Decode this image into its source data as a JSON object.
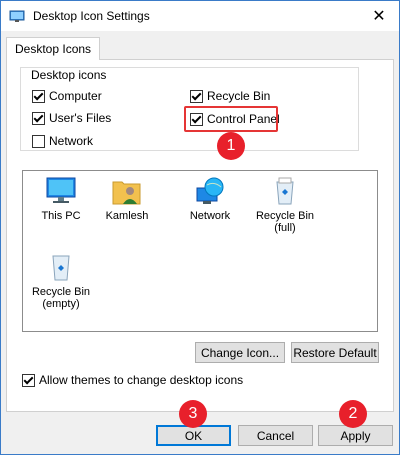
{
  "window": {
    "title": "Desktop Icon Settings",
    "close_glyph": "✕"
  },
  "tabs": [
    {
      "label": "Desktop Icons"
    }
  ],
  "desktop_icons_group": {
    "legend": "Desktop icons",
    "items": [
      {
        "label": "Computer",
        "checked": true
      },
      {
        "label": "User's Files",
        "checked": true
      },
      {
        "label": "Network",
        "checked": false
      },
      {
        "label": "Recycle Bin",
        "checked": true
      },
      {
        "label": "Control Panel",
        "checked": true
      }
    ]
  },
  "icon_list": [
    {
      "label": "This PC",
      "icon": "monitor-icon"
    },
    {
      "label": "Kamlesh",
      "icon": "user-folder-icon"
    },
    {
      "label": "Network",
      "icon": "network-globe-icon"
    },
    {
      "label": "Recycle Bin\n(full)",
      "icon": "recycle-bin-full-icon"
    },
    {
      "label": "Recycle Bin\n(empty)",
      "icon": "recycle-bin-empty-icon"
    }
  ],
  "buttons": {
    "change_icon": "Change Icon...",
    "restore_default": "Restore Default",
    "ok": "OK",
    "cancel": "Cancel",
    "apply": "Apply"
  },
  "allow_themes": {
    "label": "Allow themes to change desktop icons",
    "checked": true
  },
  "annotations": [
    {
      "number": "1"
    },
    {
      "number": "2"
    },
    {
      "number": "3"
    }
  ],
  "colors": {
    "annotation_red": "#e8202b",
    "focus_blue": "#0078d7"
  }
}
